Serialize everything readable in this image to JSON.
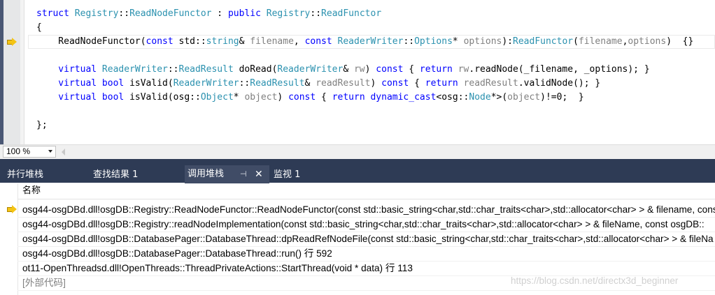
{
  "editor": {
    "lines": [
      [
        {
          "c": "kw",
          "t": "struct "
        },
        {
          "c": "ty",
          "t": "Registry"
        },
        {
          "c": "tx",
          "t": "::"
        },
        {
          "c": "ty",
          "t": "ReadNodeFunctor"
        },
        {
          "c": "tx",
          "t": " : "
        },
        {
          "c": "kw",
          "t": "public "
        },
        {
          "c": "ty",
          "t": "Registry"
        },
        {
          "c": "tx",
          "t": "::"
        },
        {
          "c": "ty",
          "t": "ReadFunctor"
        }
      ],
      [
        {
          "c": "tx",
          "t": "{"
        }
      ],
      [
        {
          "c": "tx",
          "t": "    ReadNodeFunctor("
        },
        {
          "c": "kw",
          "t": "const "
        },
        {
          "c": "tx",
          "t": "std::"
        },
        {
          "c": "ty",
          "t": "string"
        },
        {
          "c": "tx",
          "t": "& "
        },
        {
          "c": "pm",
          "t": "filename"
        },
        {
          "c": "tx",
          "t": ", "
        },
        {
          "c": "kw",
          "t": "const "
        },
        {
          "c": "ty",
          "t": "ReaderWriter"
        },
        {
          "c": "tx",
          "t": "::"
        },
        {
          "c": "ty",
          "t": "Options"
        },
        {
          "c": "tx",
          "t": "* "
        },
        {
          "c": "pm",
          "t": "options"
        },
        {
          "c": "tx",
          "t": "):"
        },
        {
          "c": "ty",
          "t": "ReadFunctor"
        },
        {
          "c": "tx",
          "t": "("
        },
        {
          "c": "pm",
          "t": "filename"
        },
        {
          "c": "tx",
          "t": ","
        },
        {
          "c": "pm",
          "t": "options"
        },
        {
          "c": "tx",
          "t": ")  {}"
        }
      ],
      [],
      [
        {
          "c": "kw",
          "t": "    virtual "
        },
        {
          "c": "ty",
          "t": "ReaderWriter"
        },
        {
          "c": "tx",
          "t": "::"
        },
        {
          "c": "ty",
          "t": "ReadResult"
        },
        {
          "c": "tx",
          "t": " doRead("
        },
        {
          "c": "ty",
          "t": "ReaderWriter"
        },
        {
          "c": "tx",
          "t": "& "
        },
        {
          "c": "pm",
          "t": "rw"
        },
        {
          "c": "tx",
          "t": ") "
        },
        {
          "c": "kw",
          "t": "const "
        },
        {
          "c": "tx",
          "t": "{ "
        },
        {
          "c": "kw",
          "t": "return "
        },
        {
          "c": "pm",
          "t": "rw"
        },
        {
          "c": "tx",
          "t": ".readNode(_filename, _options); }"
        }
      ],
      [
        {
          "c": "kw",
          "t": "    virtual bool "
        },
        {
          "c": "tx",
          "t": "isValid("
        },
        {
          "c": "ty",
          "t": "ReaderWriter"
        },
        {
          "c": "tx",
          "t": "::"
        },
        {
          "c": "ty",
          "t": "ReadResult"
        },
        {
          "c": "tx",
          "t": "& "
        },
        {
          "c": "pm",
          "t": "readResult"
        },
        {
          "c": "tx",
          "t": ") "
        },
        {
          "c": "kw",
          "t": "const "
        },
        {
          "c": "tx",
          "t": "{ "
        },
        {
          "c": "kw",
          "t": "return "
        },
        {
          "c": "pm",
          "t": "readResult"
        },
        {
          "c": "tx",
          "t": ".validNode(); }"
        }
      ],
      [
        {
          "c": "kw",
          "t": "    virtual bool "
        },
        {
          "c": "tx",
          "t": "isValid(osg::"
        },
        {
          "c": "ty",
          "t": "Object"
        },
        {
          "c": "tx",
          "t": "* "
        },
        {
          "c": "pm",
          "t": "object"
        },
        {
          "c": "tx",
          "t": ") "
        },
        {
          "c": "kw",
          "t": "const "
        },
        {
          "c": "tx",
          "t": "{ "
        },
        {
          "c": "kw",
          "t": "return dynamic_cast"
        },
        {
          "c": "tx",
          "t": "<osg::"
        },
        {
          "c": "ty",
          "t": "Node"
        },
        {
          "c": "tx",
          "t": "*>("
        },
        {
          "c": "pm",
          "t": "object"
        },
        {
          "c": "tx",
          "t": ")!=0;  }"
        }
      ],
      [],
      [
        {
          "c": "tx",
          "t": "};"
        }
      ]
    ]
  },
  "colors": {
    "keyword": "#0000ff",
    "type": "#2b91af",
    "param": "#808080",
    "tab_strip": "#2e3b55",
    "current_arrow": "#f4c414"
  },
  "zoom": {
    "value": "100 %"
  },
  "tabs": {
    "parallel_stacks": "并行堆栈",
    "find_results": "查找结果 1",
    "call_stack": "调用堆栈",
    "watch": "监视 1"
  },
  "icons": {
    "pin": "pin-icon",
    "close": "close-icon",
    "current_frame": "yellow-arrow-icon"
  },
  "call_stack": {
    "column_name": "名称",
    "frames": [
      "osg44-osgDBd.dll!osgDB::Registry::ReadNodeFunctor::ReadNodeFunctor(const std::basic_string<char,std::char_traits<char>,std::allocator<char> > & filename, const",
      "osg44-osgDBd.dll!osgDB::Registry::readNodeImplementation(const std::basic_string<char,std::char_traits<char>,std::allocator<char> > & fileName, const osgDB::",
      "osg44-osgDBd.dll!osgDB::DatabasePager::DatabaseThread::dpReadRefNodeFile(const std::basic_string<char,std::char_traits<char>,std::allocator<char> > & fileNa",
      "osg44-osgDBd.dll!osgDB::DatabasePager::DatabaseThread::run() 行 592",
      "ot11-OpenThreadsd.dll!OpenThreads::ThreadPrivateActions::StartThread(void * data) 行 113",
      "[外部代码]"
    ]
  },
  "watermark": "https://blog.csdn.net/directx3d_beginner"
}
